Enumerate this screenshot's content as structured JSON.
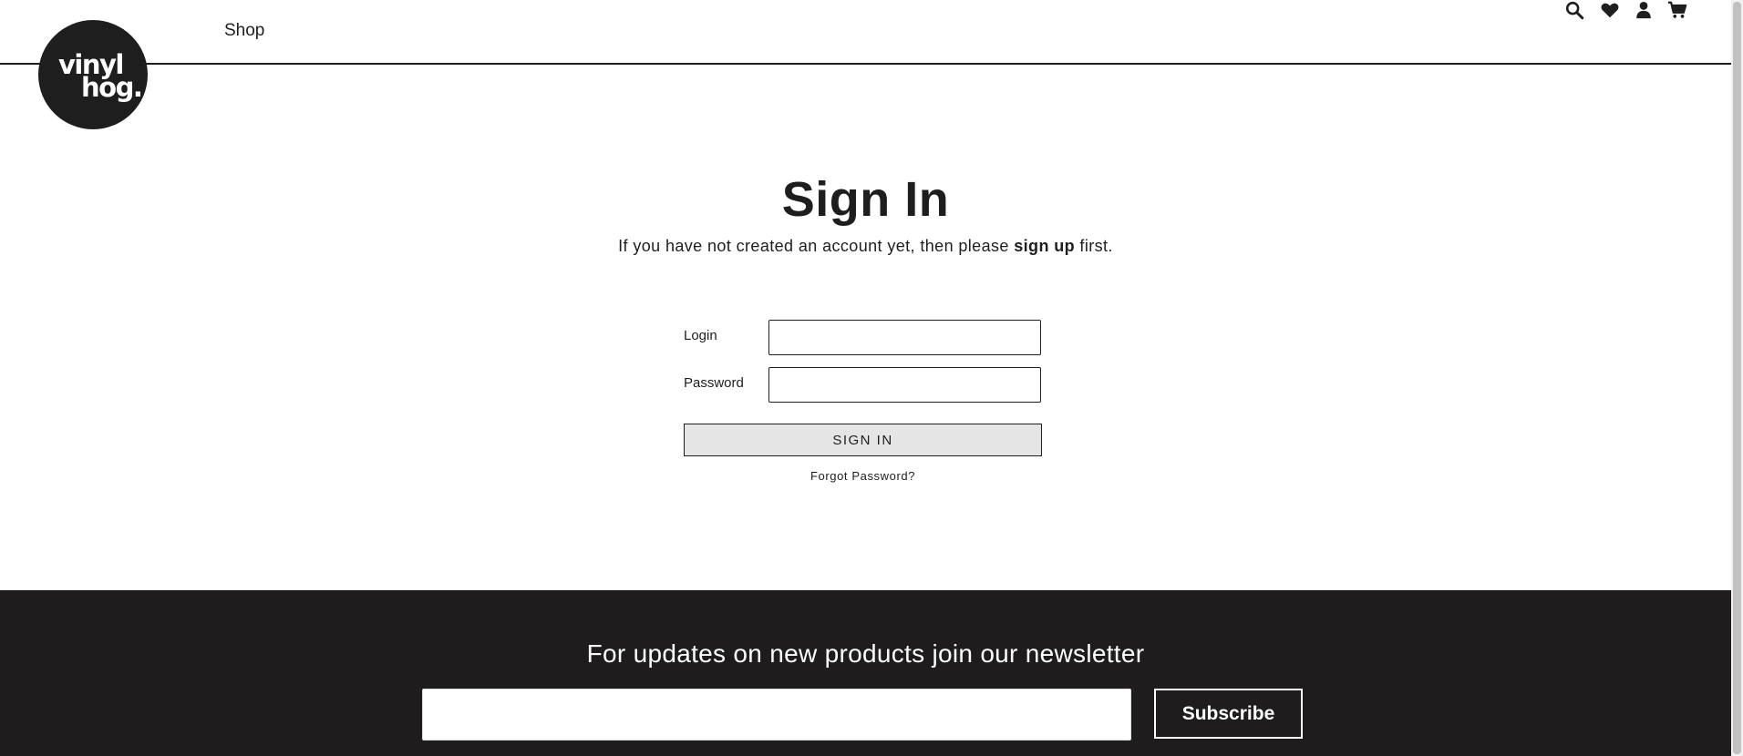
{
  "header": {
    "logo_line1": "vinyl",
    "logo_line2": "hog.",
    "nav_shop": "Shop"
  },
  "icons": [
    "search-icon",
    "heart-icon",
    "user-icon",
    "cart-icon"
  ],
  "main": {
    "title": "Sign In",
    "subtitle_prefix": "If you have not created an account yet, then please ",
    "subtitle_link": "sign up",
    "subtitle_suffix": " first.",
    "login_label": "Login",
    "login_value": "",
    "password_label": "Password",
    "password_value": "",
    "signin_button": "SIGN IN",
    "forgot_link": "Forgot Password?"
  },
  "footer": {
    "newsletter_heading": "For updates on new products join our newsletter",
    "email_value": "",
    "subscribe_button": "Subscribe"
  },
  "colors": {
    "primary_dark": "#1e1e1e",
    "footer_bg": "#1e1c1d",
    "button_bg": "#e5e5e5"
  }
}
